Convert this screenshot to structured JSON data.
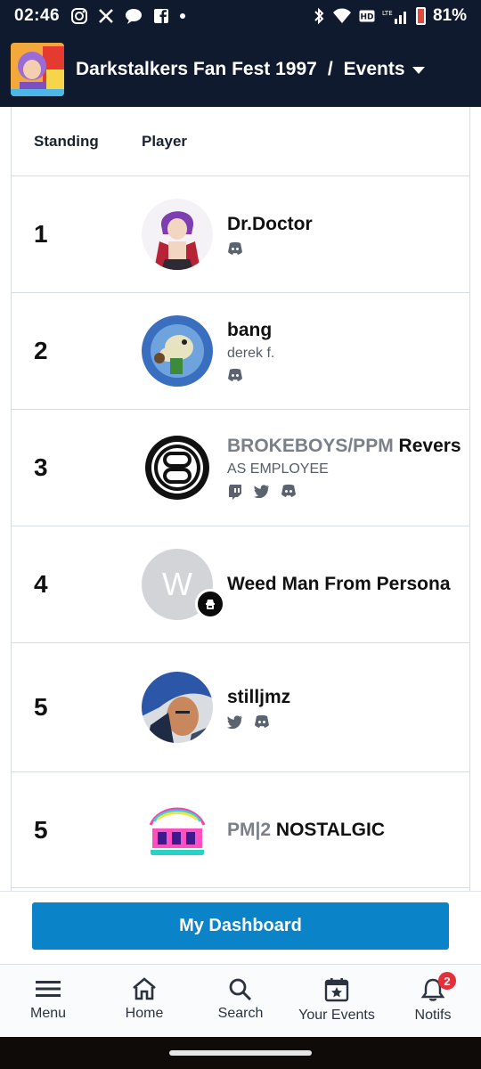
{
  "status_bar": {
    "time": "02:46",
    "battery": "81%",
    "network": "LTE"
  },
  "header": {
    "event_title": "Darkstalkers Fan Fest 1997",
    "separator": "/",
    "section": "Events",
    "logo_icon": "event-logo-image"
  },
  "table": {
    "columns": [
      "Standing",
      "Player"
    ],
    "rows": [
      {
        "standing": "1",
        "prefix": "",
        "name": "Dr.Doctor",
        "subtitle": "",
        "socials": [
          "discord-icon"
        ]
      },
      {
        "standing": "2",
        "prefix": "",
        "name": "bang",
        "subtitle": "derek f.",
        "socials": [
          "discord-icon"
        ]
      },
      {
        "standing": "3",
        "prefix": "BROKEBOYS/PPM",
        "name": "Revers",
        "subtitle": "AS EMPLOYEE",
        "socials": [
          "twitch-icon",
          "twitter-icon",
          "discord-icon"
        ]
      },
      {
        "standing": "4",
        "prefix": "",
        "name": "Weed Man From Persona",
        "subtitle": "",
        "avatar_letter": "W",
        "socials": []
      },
      {
        "standing": "5",
        "prefix": "",
        "name": "stilljmz",
        "subtitle": "",
        "socials": [
          "twitter-icon",
          "discord-icon"
        ]
      },
      {
        "standing": "5",
        "prefix": "PM|2",
        "name": "NOSTALGIC",
        "subtitle": "",
        "socials": []
      }
    ]
  },
  "dashboard_button": "My Dashboard",
  "bottom_nav": {
    "items": [
      {
        "label": "Menu",
        "icon": "menu-icon"
      },
      {
        "label": "Home",
        "icon": "home-icon"
      },
      {
        "label": "Search",
        "icon": "search-icon"
      },
      {
        "label": "Your Events",
        "icon": "calendar-star-icon"
      },
      {
        "label": "Notifs",
        "icon": "bell-icon",
        "badge": "2"
      }
    ]
  },
  "colors": {
    "header_bg": "#0f1a2e",
    "accent": "#0b83c9",
    "badge": "#e2313b"
  }
}
